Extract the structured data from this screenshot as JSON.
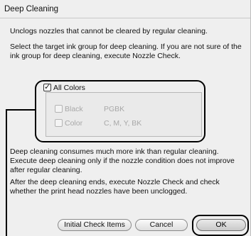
{
  "dialog": {
    "title": "Deep Cleaning",
    "description": "Unclogs nozzles that cannot be cleared by regular cleaning.",
    "instruction": "Select the target ink group for deep cleaning. If you are not sure of the ink group for deep cleaning, execute Nozzle Check.",
    "warning": "Deep cleaning consumes much more ink than regular cleaning. Execute deep cleaning only if the nozzle condition does not improve after regular cleaning.",
    "after_text": "After the deep cleaning ends, execute Nozzle Check and check whether the print head nozzles have been unclogged."
  },
  "ink_groups": {
    "all_colors": {
      "label": "All Colors",
      "checked": true
    },
    "black": {
      "label": "Black",
      "inks": "PGBK",
      "checked": false,
      "enabled": false
    },
    "color": {
      "label": "Color",
      "inks": "C, M, Y, BK",
      "checked": false,
      "enabled": false
    }
  },
  "buttons": {
    "initial_check": "Initial Check Items",
    "cancel": "Cancel",
    "ok": "OK"
  }
}
